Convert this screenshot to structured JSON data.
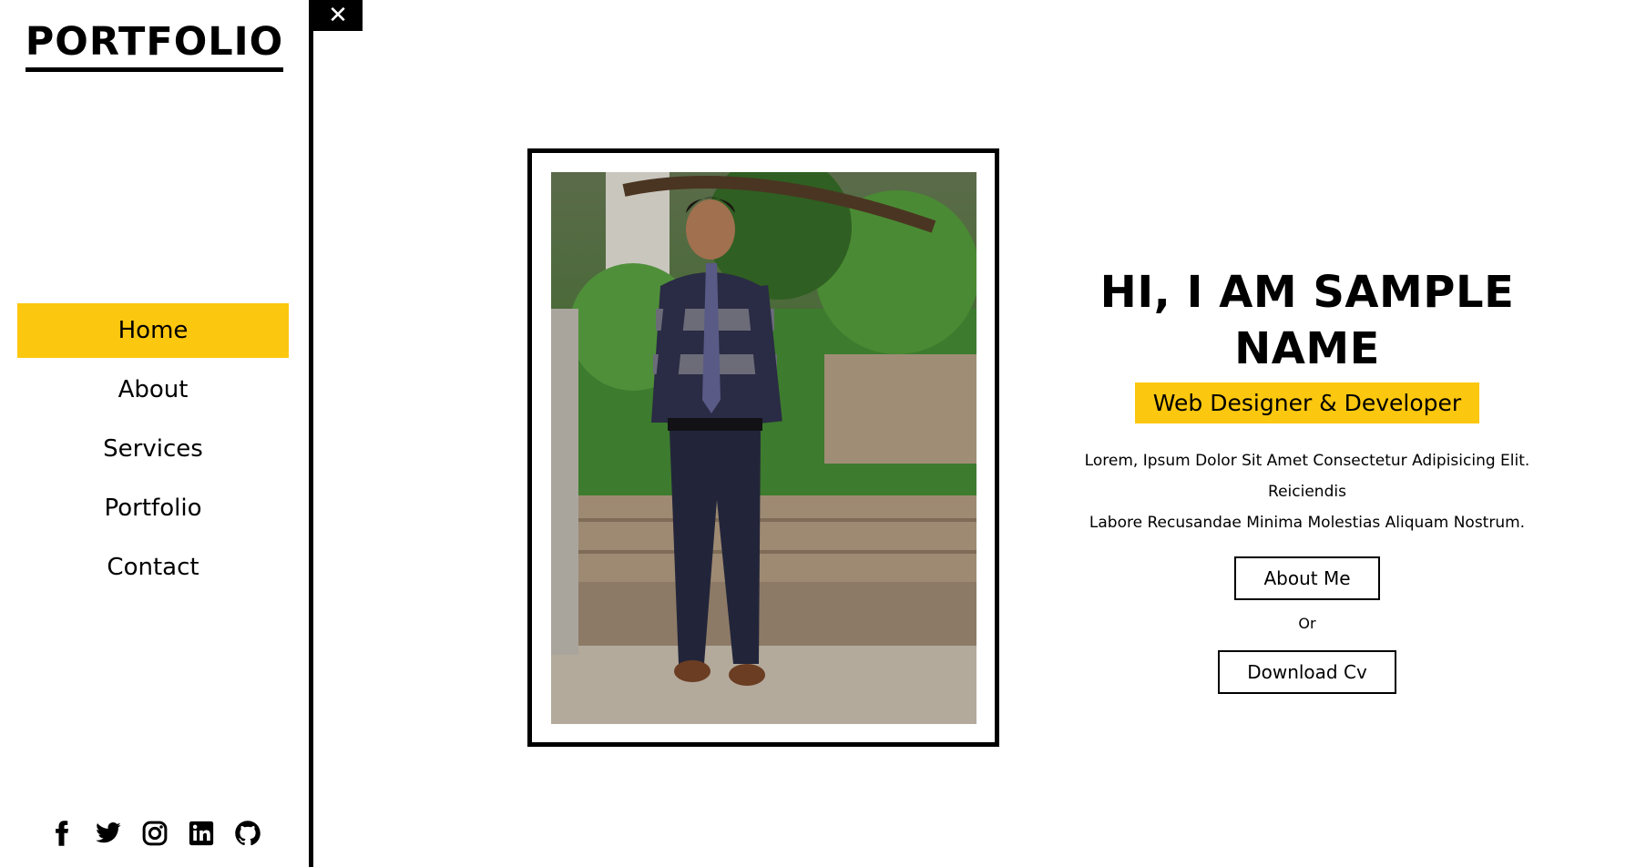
{
  "sidebar": {
    "brand": "PORTFOLIO",
    "nav": [
      {
        "label": "Home",
        "active": true
      },
      {
        "label": "About",
        "active": false
      },
      {
        "label": "Services",
        "active": false
      },
      {
        "label": "Portfolio",
        "active": false
      },
      {
        "label": "Contact",
        "active": false
      }
    ],
    "socials": [
      "facebook-icon",
      "twitter-icon",
      "instagram-icon",
      "linkedin-icon",
      "github-icon"
    ]
  },
  "close_icon": "close-icon",
  "hero": {
    "title": "HI, I AM SAMPLE NAME",
    "role": "Web Designer & Developer",
    "description_line1": "Lorem, Ipsum Dolor Sit Amet Consectetur Adipisicing Elit. Reiciendis",
    "description_line2": "Labore Recusandae Minima Molestias Aliquam Nostrum.",
    "about_button": "About Me",
    "or_text": "Or",
    "cv_button": "Download Cv"
  },
  "colors": {
    "accent": "#fcc70f",
    "text": "#000000",
    "background": "#ffffff"
  }
}
